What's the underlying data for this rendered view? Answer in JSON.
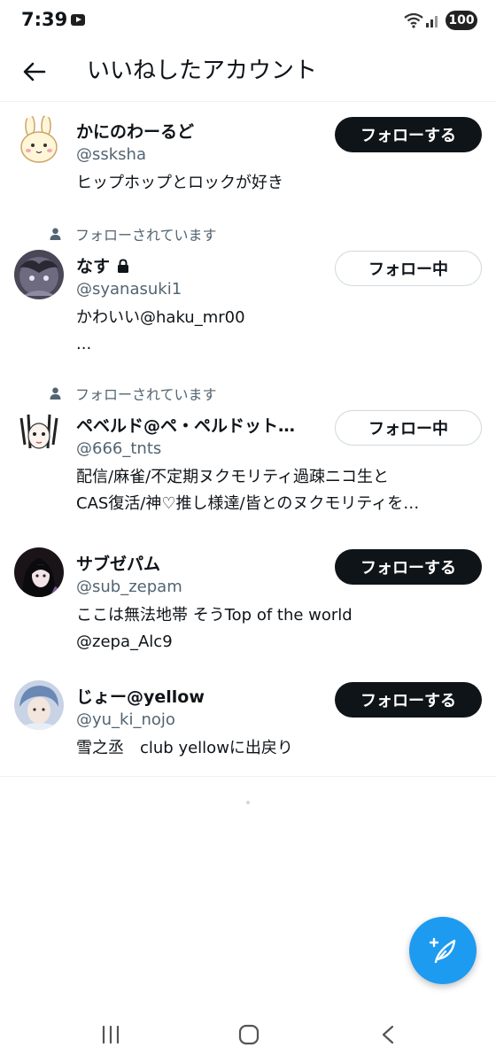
{
  "status": {
    "time": "7:39",
    "battery": "100"
  },
  "header": {
    "title": "いいねしたアカウント"
  },
  "users": [
    {
      "name": "かにのわーるど",
      "handle": "@ssksha",
      "bio": [
        "ヒップホップとロックが好き"
      ],
      "button": "フォローする",
      "follows_you": "",
      "locked": false
    },
    {
      "name": "なす",
      "handle": "@syanasuki1",
      "bio": [
        "かわいい@haku_mr00",
        "..."
      ],
      "button": "フォロー中",
      "follows_you": "フォローされています",
      "locked": true
    },
    {
      "name": "ペベルド@ペ・ペルドット…",
      "handle": "@666_tnts",
      "bio": [
        "配信/麻雀/不定期ヌクモリティ過疎ニコ生と",
        "CAS復活/神♡推し様達/皆とのヌクモリティを…"
      ],
      "button": "フォロー中",
      "follows_you": "フォローされています",
      "locked": false
    },
    {
      "name": "サブゼパム",
      "handle": "@sub_zepam",
      "bio": [
        "ここは無法地帯 そうTop of the world",
        "@zepa_Alc9"
      ],
      "button": "フォローする",
      "follows_you": "",
      "locked": false
    },
    {
      "name": "じょー@yellow",
      "handle": "@yu_ki_nojo",
      "bio": [
        "雪之丞　club yellowに出戻り"
      ],
      "button": "フォローする",
      "follows_you": "",
      "locked": false
    }
  ],
  "colors": {
    "accent": "#1d9bf0",
    "text": "#0f1419",
    "secondary": "#536471",
    "button_dark": "#0f1419"
  },
  "icons": {
    "back": "arrow-left-icon",
    "compose": "feather-plus-icon",
    "lock": "lock-icon",
    "person": "person-icon"
  }
}
